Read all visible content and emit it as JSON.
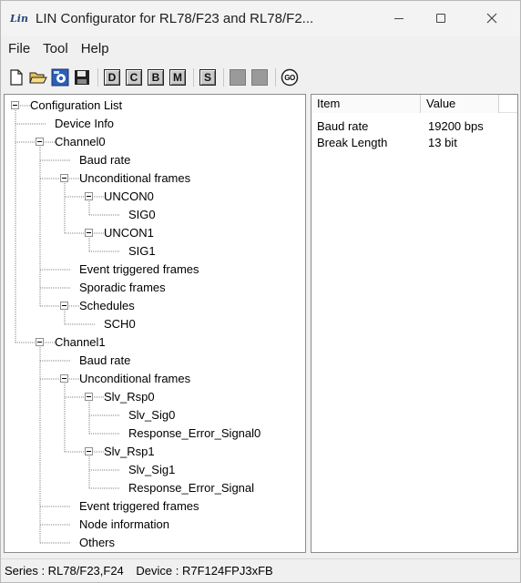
{
  "window": {
    "title": "LIN Configurator for RL78/F23 and RL78/F2...",
    "icon": "lin-app-icon",
    "icon_text": "Lin"
  },
  "menu": [
    "File",
    "Tool",
    "Help"
  ],
  "toolbar": {
    "letter_buttons": [
      "D",
      "C",
      "B",
      "M",
      "S"
    ],
    "go_label": "GO"
  },
  "tree": {
    "nodes": [
      {
        "label": "Configuration List",
        "level": 0,
        "expandable": true
      },
      {
        "label": "Device Info",
        "level": 1,
        "expandable": false
      },
      {
        "label": "Channel0",
        "level": 1,
        "expandable": true
      },
      {
        "label": "Baud rate",
        "level": 2,
        "expandable": false
      },
      {
        "label": "Unconditional frames",
        "level": 2,
        "expandable": true
      },
      {
        "label": "UNCON0",
        "level": 3,
        "expandable": true
      },
      {
        "label": "SIG0",
        "level": 4,
        "expandable": false
      },
      {
        "label": "UNCON1",
        "level": 3,
        "expandable": true
      },
      {
        "label": "SIG1",
        "level": 4,
        "expandable": false
      },
      {
        "label": "Event triggered frames",
        "level": 2,
        "expandable": false
      },
      {
        "label": "Sporadic frames",
        "level": 2,
        "expandable": false
      },
      {
        "label": "Schedules",
        "level": 2,
        "expandable": true
      },
      {
        "label": "SCH0",
        "level": 3,
        "expandable": false
      },
      {
        "label": "Channel1",
        "level": 1,
        "expandable": true
      },
      {
        "label": "Baud rate",
        "level": 2,
        "expandable": false
      },
      {
        "label": "Unconditional frames",
        "level": 2,
        "expandable": true
      },
      {
        "label": "Slv_Rsp0",
        "level": 3,
        "expandable": true
      },
      {
        "label": "Slv_Sig0",
        "level": 4,
        "expandable": false
      },
      {
        "label": "Response_Error_Signal0",
        "level": 4,
        "expandable": false
      },
      {
        "label": "Slv_Rsp1",
        "level": 3,
        "expandable": true
      },
      {
        "label": "Slv_Sig1",
        "level": 4,
        "expandable": false
      },
      {
        "label": "Response_Error_Signal",
        "level": 4,
        "expandable": false
      },
      {
        "label": "Event triggered frames",
        "level": 2,
        "expandable": false
      },
      {
        "label": "Node information",
        "level": 2,
        "expandable": false
      },
      {
        "label": "Others",
        "level": 2,
        "expandable": false
      }
    ]
  },
  "properties": {
    "columns": [
      "Item",
      "Value"
    ],
    "rows": [
      {
        "item": "Baud rate",
        "value": "19200 bps"
      },
      {
        "item": "Break Length",
        "value": "13 bit"
      }
    ]
  },
  "status": {
    "series": "Series : RL78/F23,F24",
    "device": "Device : R7F124FPJ3xFB"
  }
}
